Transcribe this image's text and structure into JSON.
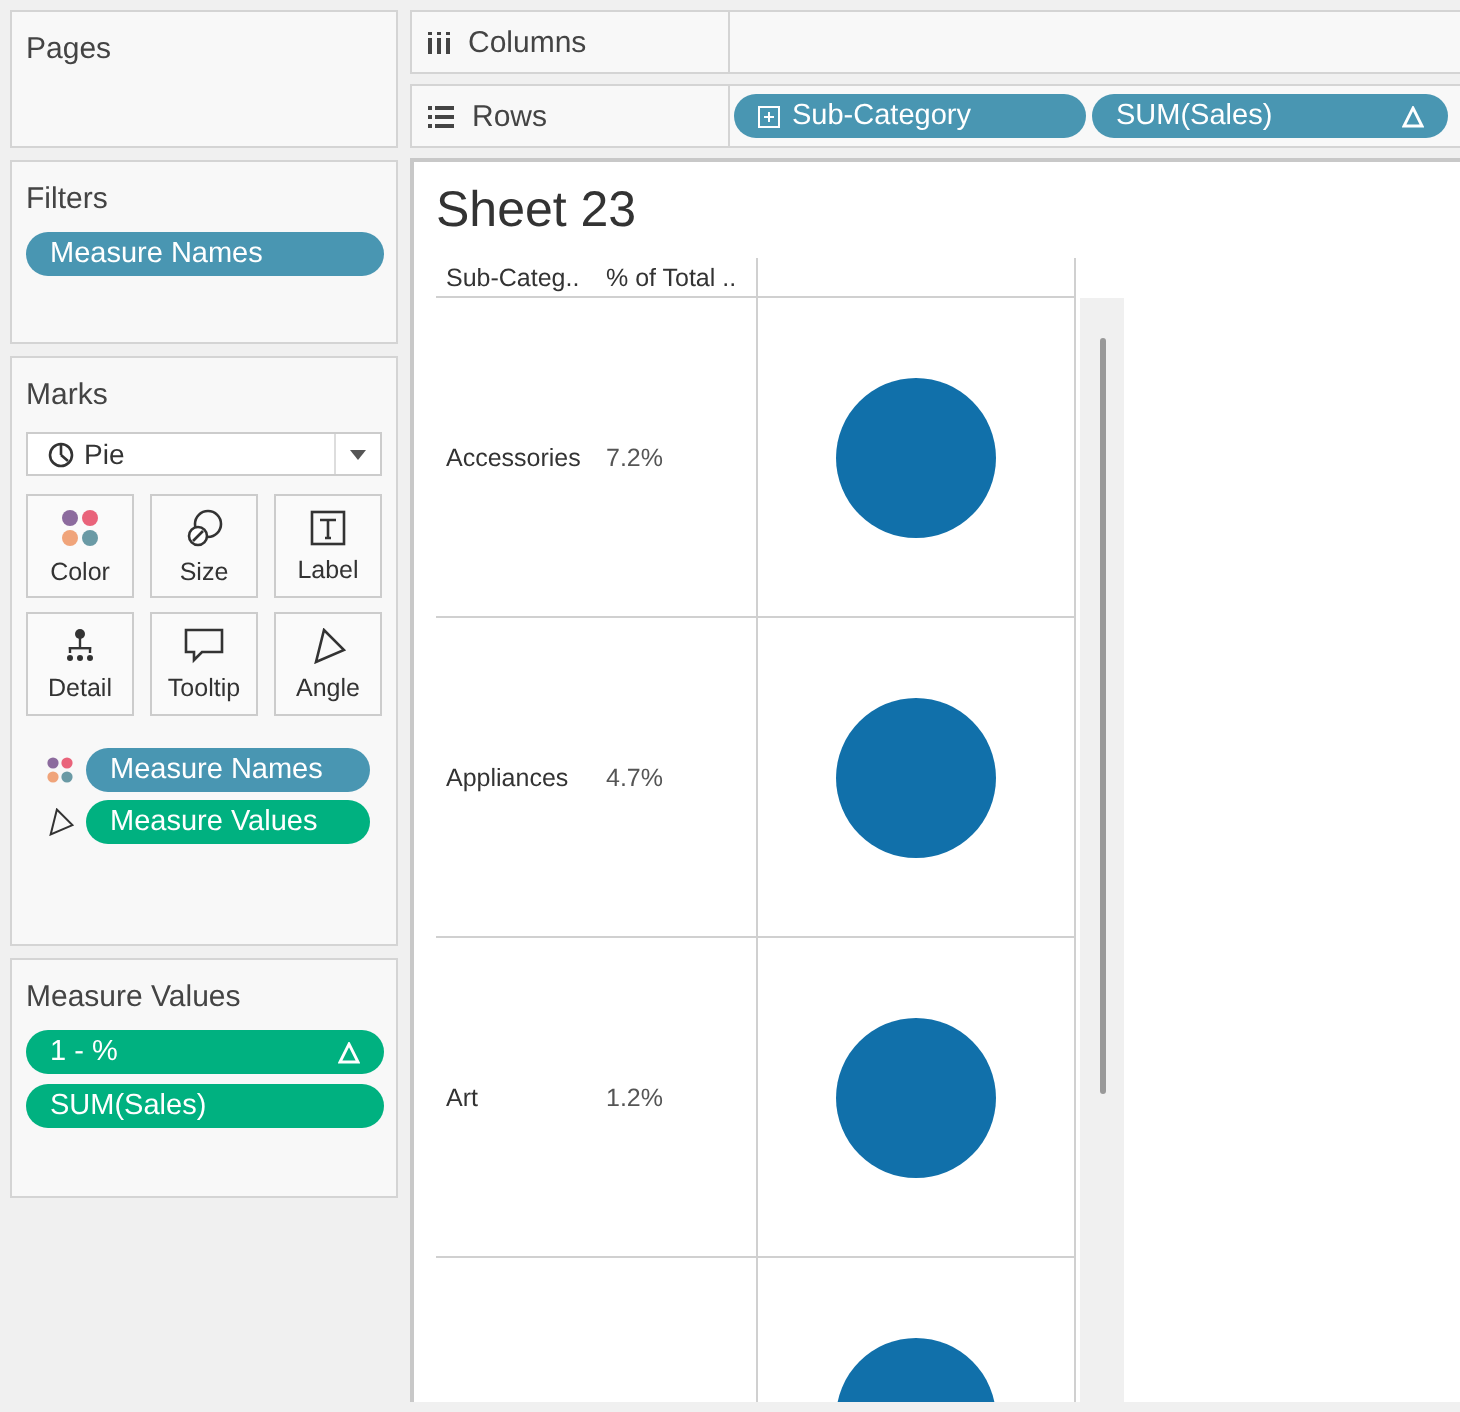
{
  "pages": {
    "title": "Pages"
  },
  "filters": {
    "title": "Filters",
    "pills": [
      {
        "label": "Measure Names",
        "kind": "discrete",
        "table_calc": false
      }
    ]
  },
  "marks": {
    "title": "Marks",
    "mark_type": "Pie",
    "buttons": [
      {
        "label": "Color",
        "kind": "color"
      },
      {
        "label": "Size",
        "kind": "size"
      },
      {
        "label": "Label",
        "kind": "label"
      },
      {
        "label": "Detail",
        "kind": "detail"
      },
      {
        "label": "Tooltip",
        "kind": "tooltip"
      },
      {
        "label": "Angle",
        "kind": "angle"
      }
    ],
    "fields": [
      {
        "kind": "color",
        "pill": {
          "label": "Measure Names",
          "kind": "discrete"
        }
      },
      {
        "kind": "angle",
        "pill": {
          "label": "Measure Values",
          "kind": "continuous"
        }
      }
    ]
  },
  "measure_values": {
    "title": "Measure Values",
    "pills": [
      {
        "label": "1 - %",
        "kind": "continuous",
        "table_calc": true
      },
      {
        "label": "SUM(Sales)",
        "kind": "continuous",
        "table_calc": false
      }
    ]
  },
  "shelves": [
    {
      "label": "Columns",
      "kind": "columns"
    },
    {
      "label": "Rows",
      "kind": "rows",
      "pills": [
        {
          "label": "Sub-Category",
          "kind": "discrete",
          "expandable": true,
          "table_calc": false
        },
        {
          "label": "SUM(Sales)",
          "kind": "discrete",
          "expandable": false,
          "table_calc": true
        }
      ]
    }
  ],
  "sheet": {
    "title": "Sheet 23",
    "columns": [
      "Sub-Categ..",
      "% of Total .."
    ],
    "rows": [
      {
        "kind": "full",
        "sub_category": "Accessories",
        "percent": "7.2%"
      },
      {
        "kind": "full",
        "sub_category": "Appliances",
        "percent": "4.7%"
      },
      {
        "kind": "full",
        "sub_category": "Art",
        "percent": "1.2%"
      },
      {
        "kind": "cut_off"
      }
    ]
  }
}
